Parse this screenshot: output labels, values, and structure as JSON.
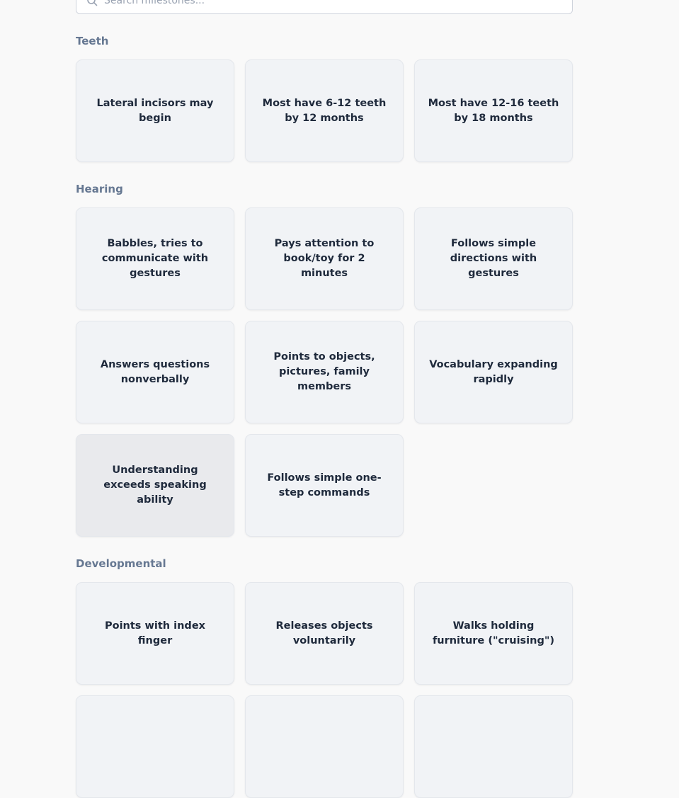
{
  "search": {
    "placeholder": "Search milestones..."
  },
  "sections": [
    {
      "title": "Teeth",
      "cards": [
        "Lateral incisors may begin",
        "Most have 6-12 teeth by 12 months",
        "Most have 12-16 teeth by 18 months"
      ]
    },
    {
      "title": "Hearing",
      "cards": [
        "Babbles, tries to communicate with gestures",
        "Pays attention to book/toy for 2 minutes",
        "Follows simple directions with gestures",
        "Answers questions nonverbally",
        "Points to objects, pictures, family members",
        "Vocabulary expanding rapidly",
        "Understanding exceeds speaking ability",
        "Follows simple one-step commands"
      ]
    },
    {
      "title": "Developmental",
      "cards": [
        "Points with index finger",
        "Releases objects voluntarily",
        "Walks holding furniture (\"cruising\")",
        "",
        "",
        ""
      ]
    }
  ],
  "colors": {
    "background": "#f9f9f9",
    "card_background": "#f1f3f6",
    "card_hover_background": "#e9eaed",
    "section_title": "#667892",
    "card_text": "#1f2a3c"
  },
  "icons": {
    "search": "search-icon"
  }
}
